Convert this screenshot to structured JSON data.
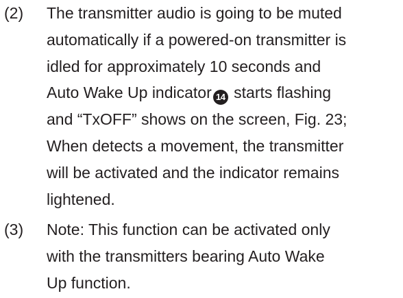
{
  "items": [
    {
      "number": "(2)",
      "lines": [
        "The transmitter audio is going to be muted",
        "automatically if a powered-on transmitter is",
        "idled for approximately 10 seconds and",
        {
          "before": "Auto Wake Up indicator",
          "badge": "14",
          "after": " starts flashing"
        },
        "and “TxOFF” shows on the screen, Fig. 23;",
        "When detects a movement, the transmitter",
        "will be activated and the indicator remains",
        "lightened."
      ]
    },
    {
      "number": "(3)",
      "lines": [
        "Note: This function can be activated only",
        "with the transmitters bearing Auto Wake",
        "Up function."
      ]
    }
  ]
}
